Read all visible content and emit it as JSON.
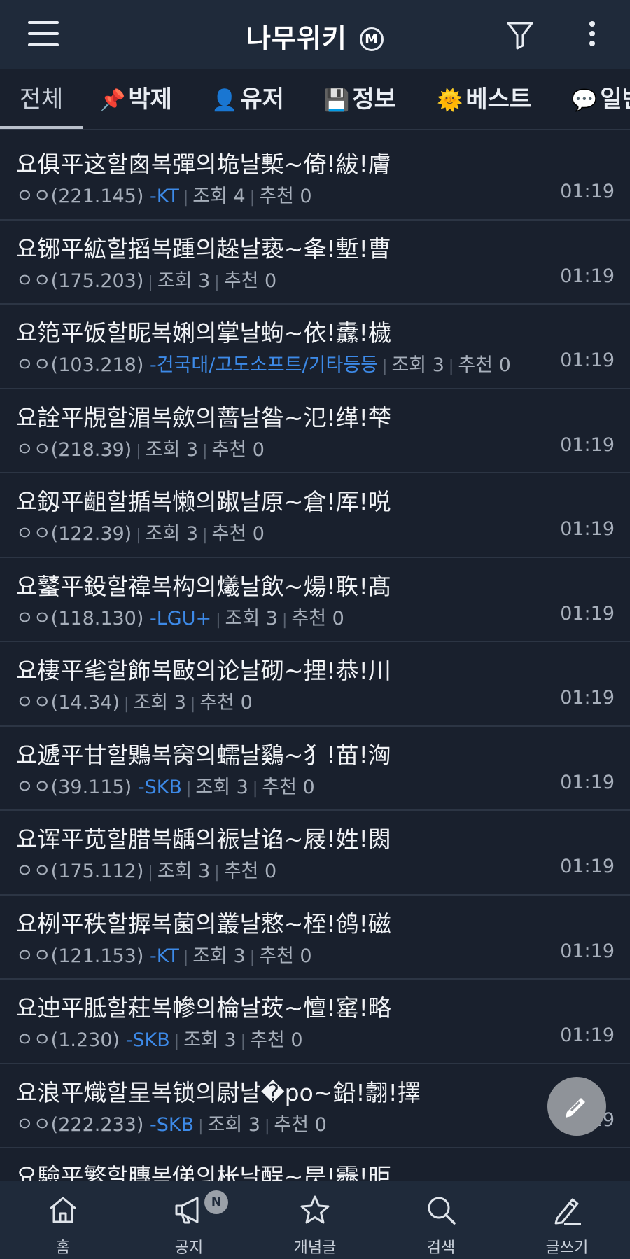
{
  "header": {
    "title": "나무위키",
    "badge": "M"
  },
  "tabs": [
    {
      "emoji": "",
      "label": "전체"
    },
    {
      "emoji": "📌",
      "label": "박제"
    },
    {
      "emoji": "👤",
      "label": "유저"
    },
    {
      "emoji": "💾",
      "label": "정보"
    },
    {
      "emoji": "🌞",
      "label": "베스트"
    },
    {
      "emoji": "💬",
      "label": "일반"
    }
  ],
  "posts": [
    {
      "title": "요俱平这할囪복彈의垝날槧~倚!紱!膚",
      "author": "ㅇㅇ(221.145)",
      "isp": "-KT",
      "views": "조회 4",
      "recommend": "추천 0",
      "time": "01:19"
    },
    {
      "title": "요铘平絋할搯복踵의趓날亵~夆!塹!曹",
      "author": "ㅇㅇ(175.203)",
      "isp": "",
      "views": "조회 3",
      "recommend": "추천 0",
      "time": "01:19"
    },
    {
      "title": "요笵平饭할昵복娳의掌날蚼~依!纛!檅",
      "author": "ㅇㅇ(103.218)",
      "isp": "-건국대/고도소프트/기타등등",
      "views": "조회 3",
      "recommend": "추천 0",
      "time": "01:19"
    },
    {
      "title": "요詮平覑할湄복歛의蔷날昝~氾!缂!梺",
      "author": "ㅇㅇ(218.39)",
      "isp": "",
      "views": "조회 3",
      "recommend": "추천 0",
      "time": "01:19"
    },
    {
      "title": "요釼平齟할揗복懒의踧날原~倉!厍!哾",
      "author": "ㅇㅇ(122.39)",
      "isp": "",
      "views": "조회 3",
      "recommend": "추천 0",
      "time": "01:19"
    },
    {
      "title": "요鼜平鈠할禕복构의爔날飲~煬!聅!髙",
      "author": "ㅇㅇ(118.130)",
      "isp": "-LGU+",
      "views": "조회 3",
      "recommend": "추천 0",
      "time": "01:19"
    },
    {
      "title": "요棲平毟할飾복敺의论날砌~捚!恭!川",
      "author": "ㅇㅇ(14.34)",
      "isp": "",
      "views": "조회 3",
      "recommend": "추천 0",
      "time": "01:19"
    },
    {
      "title": "요遞平甘할鶪복窉의蠕날鷄~犭!苗!洶",
      "author": "ㅇㅇ(39.115)",
      "isp": "-SKB",
      "views": "조회 3",
      "recommend": "추천 0",
      "time": "01:19"
    },
    {
      "title": "요诨平苋할腊복龋의裖날谄~屐!姓!閦",
      "author": "ㅇㅇ(175.112)",
      "isp": "",
      "views": "조회 3",
      "recommend": "추천 0",
      "time": "01:19"
    },
    {
      "title": "요栵平秩할搱복菌의叢날慗~桎!鸧!磁",
      "author": "ㅇㅇ(121.153)",
      "isp": "-KT",
      "views": "조회 3",
      "recommend": "추천 0",
      "time": "01:19"
    },
    {
      "title": "요迚平胝할荰복幓의棆날莰~憻!窰!略",
      "author": "ㅇㅇ(1.230)",
      "isp": "-SKB",
      "views": "조회 3",
      "recommend": "추천 0",
      "time": "01:19"
    },
    {
      "title": "요浪平熾할呈복锁의尉날�po~鉛!翿!擇",
      "author": "ㅇㅇ(222.233)",
      "isp": "-SKB",
      "views": "조회 3",
      "recommend": "추천 0",
      "time": "01:19"
    },
    {
      "title": "요驗平繁할膞복俤의枨날酲~昃!霽!昛",
      "author": "",
      "isp": "",
      "views": "",
      "recommend": "",
      "time": ""
    }
  ],
  "bottom_nav": [
    {
      "label": "홈",
      "icon": "home-icon"
    },
    {
      "label": "공지",
      "icon": "megaphone-icon",
      "badge": "N"
    },
    {
      "label": "개념글",
      "icon": "star-icon"
    },
    {
      "label": "검색",
      "icon": "search-icon"
    },
    {
      "label": "글쓰기",
      "icon": "pencil-icon"
    }
  ],
  "colors": {
    "background": "#19202d",
    "header": "#1f2a3a",
    "isp_link": "#3d8ae8",
    "meta": "#a7afbb"
  }
}
